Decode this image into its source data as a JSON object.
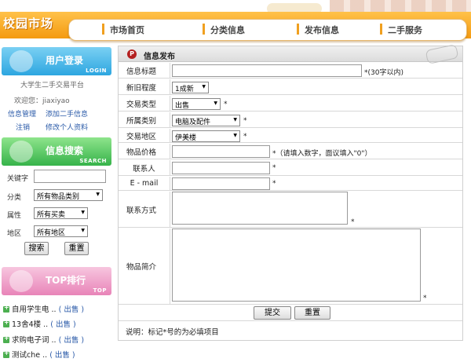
{
  "header": {
    "logo": "校园市场",
    "nav": [
      "市场首页",
      "分类信息",
      "发布信息",
      "二手服务"
    ]
  },
  "sidebar": {
    "login": {
      "title": "用户登录",
      "subtitle": "LOGIN",
      "platform": "大学生二手交易平台",
      "welcome": "欢迎您：jiaxiyao",
      "links": [
        "信息管理",
        "添加二手信息",
        "注销",
        "修改个人资料"
      ]
    },
    "search": {
      "title": "信息搜索",
      "subtitle": "SEARCH",
      "keyword_label": "关键字",
      "keyword_value": "",
      "category_label": "分类",
      "category_value": "所有物品类别",
      "attr_label": "属性",
      "attr_value": "所有买卖",
      "region_label": "地区",
      "region_value": "所有地区",
      "search_button": "搜索",
      "reset_button": "重置"
    },
    "top": {
      "title": "TOP排行",
      "subtitle": "TOP",
      "items": [
        {
          "name": "自用学生电 ..",
          "tag": "( 出售 )"
        },
        {
          "name": "13舍4楼 ..",
          "tag": "( 出售 )"
        },
        {
          "name": "求购电子词 ..",
          "tag": "( 出售 )"
        },
        {
          "name": "测试che ..",
          "tag": "( 出售 )"
        }
      ]
    }
  },
  "form": {
    "title": "信息发布",
    "fields": {
      "title_label": "信息标题",
      "title_value": "",
      "title_hint": "*(30字以内)",
      "condition_label": "新旧程度",
      "condition_value": "1成新",
      "trade_label": "交易类型",
      "trade_value": "出售",
      "category_label": "所属类别",
      "category_value": "电脑及配件",
      "region_label": "交易地区",
      "region_value": "伊美楼",
      "price_label": "物品价格",
      "price_value": "",
      "price_hint": "*（请填入数字，面议填入\"0\"）",
      "contact_label": "联系人",
      "contact_value": "",
      "email_label": "E - mail",
      "email_value": "",
      "method_label": "联系方式",
      "method_value": "",
      "desc_label": "物品简介",
      "desc_value": "",
      "star": "*"
    },
    "submit_button": "提交",
    "reset_button": "重置",
    "note": "说明：标记*号的为必填项目"
  },
  "colors": {
    "header_orange": "#f49a10",
    "nav_bar": "#f0a020",
    "login_blue": "#2da6e0",
    "search_green": "#36b34a",
    "top_pink": "#e884b8",
    "link_blue": "#2a5aa8"
  }
}
